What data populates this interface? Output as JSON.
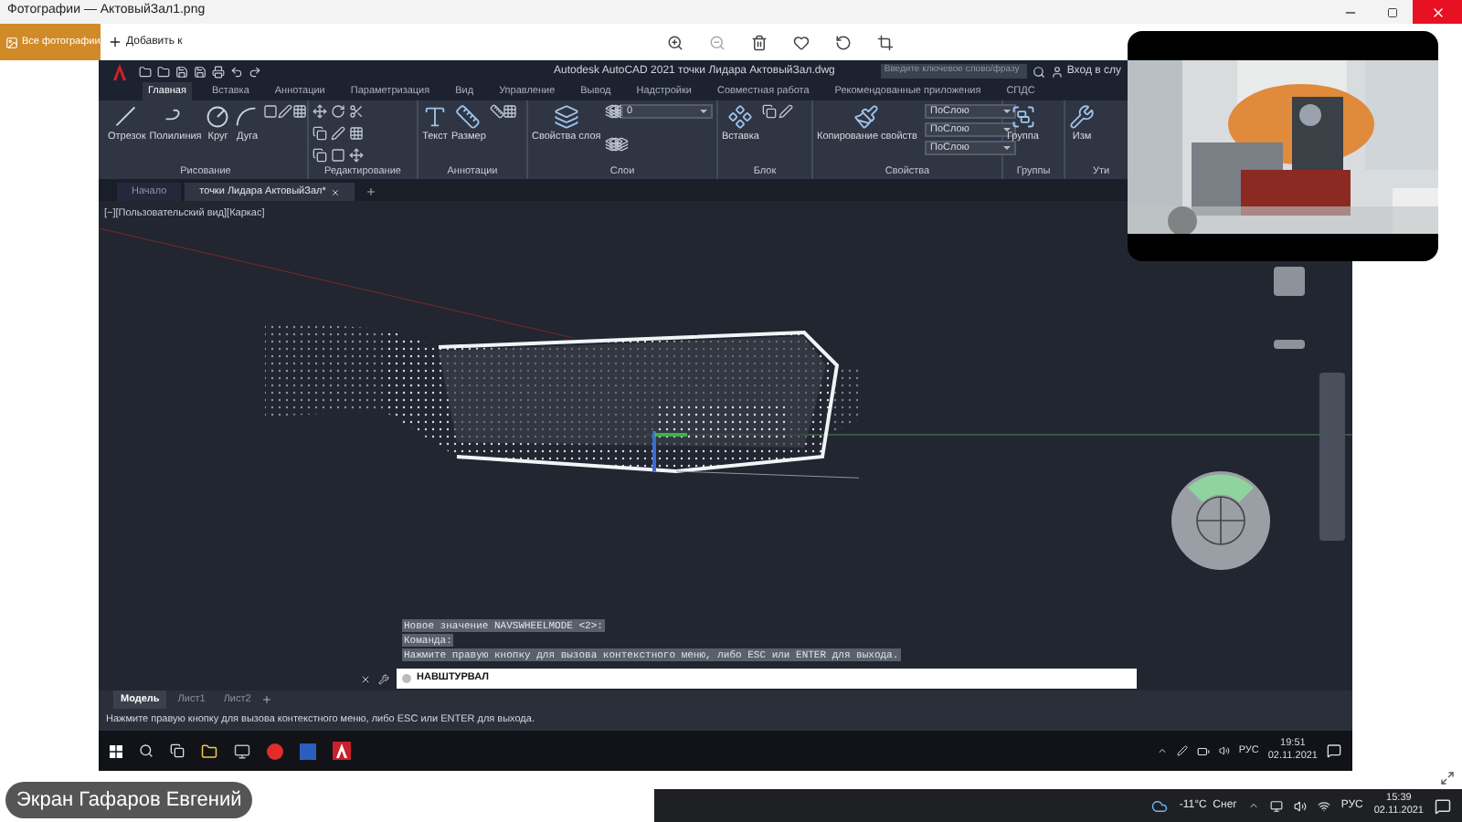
{
  "window": {
    "title": "Фотографии — АктовыйЗал1.png"
  },
  "photos_toolbar": {
    "nav_button": "Все фотографии",
    "add_button": "Добавить к"
  },
  "acad": {
    "title": "Autodesk AutoCAD 2021  точки Лидара АктовыйЗал.dwg",
    "search": {
      "placeholder": "Введите ключевое слово/фразу"
    },
    "sign_in": "Вход в слу",
    "ribbon_tabs": [
      {
        "label": "Главная",
        "selected": true
      },
      {
        "label": "Вставка",
        "selected": false
      },
      {
        "label": "Аннотации",
        "selected": false
      },
      {
        "label": "Параметризация",
        "selected": false
      },
      {
        "label": "Вид",
        "selected": false
      },
      {
        "label": "Управление",
        "selected": false
      },
      {
        "label": "Вывод",
        "selected": false
      },
      {
        "label": "Надстройки",
        "selected": false
      },
      {
        "label": "Совместная работа",
        "selected": false
      },
      {
        "label": "Рекомендованные приложения",
        "selected": false
      },
      {
        "label": "СПДС",
        "selected": false
      }
    ],
    "panels": [
      {
        "title": "Рисование",
        "tools": [
          "Отрезок",
          "Полилиния",
          "Круг",
          "Дуга"
        ]
      },
      {
        "title": "Редактирование"
      },
      {
        "title": "Аннотации",
        "tools": [
          "Текст",
          "Размер"
        ]
      },
      {
        "title": "Слои",
        "tools": [
          "Свойства слоя"
        ],
        "dropdowns": [
          "0"
        ]
      },
      {
        "title": "Блок",
        "tools": [
          "Вставка"
        ]
      },
      {
        "title": "Свойства",
        "tools": [
          "Копирование свойств"
        ],
        "dropdowns": [
          "ПоСлою",
          "ПоСлою",
          "ПоСлою"
        ]
      },
      {
        "title": "Группы",
        "tools": [
          "Группа"
        ]
      },
      {
        "title": "Ути",
        "tools": [
          "Изм"
        ]
      }
    ],
    "doc_tabs": [
      {
        "label": "Начало",
        "selected": false
      },
      {
        "label": "точки Лидара АктовыйЗал*",
        "selected": true
      }
    ],
    "viewport_label": "[−][Пользовательский вид][Каркас]",
    "command_history": [
      "Новое значение NAVSWHEELMODE <2>:",
      "Команда:",
      "Нажмите правую кнопку для вызова контекстного меню, либо ESC или ENTER для выхода."
    ],
    "command_input": "НАВШТУРВАЛ",
    "layout_tabs": [
      {
        "label": "Модель",
        "selected": true
      },
      {
        "label": "Лист1",
        "selected": false
      },
      {
        "label": "Лист2",
        "selected": false
      }
    ],
    "status_text": "Нажмите правую кнопку для вызова контекстного меню, либо ESC или ENTER для выхода.",
    "taskbar": {
      "language": "РУС",
      "time": "19:51",
      "date": "02.11.2021"
    }
  },
  "presenter_label": "Экран Гафаров Евгений",
  "host_taskbar": {
    "weather": "-11°C  Снег",
    "language": "РУС",
    "time": "15:39",
    "date": "02.11.2021"
  }
}
